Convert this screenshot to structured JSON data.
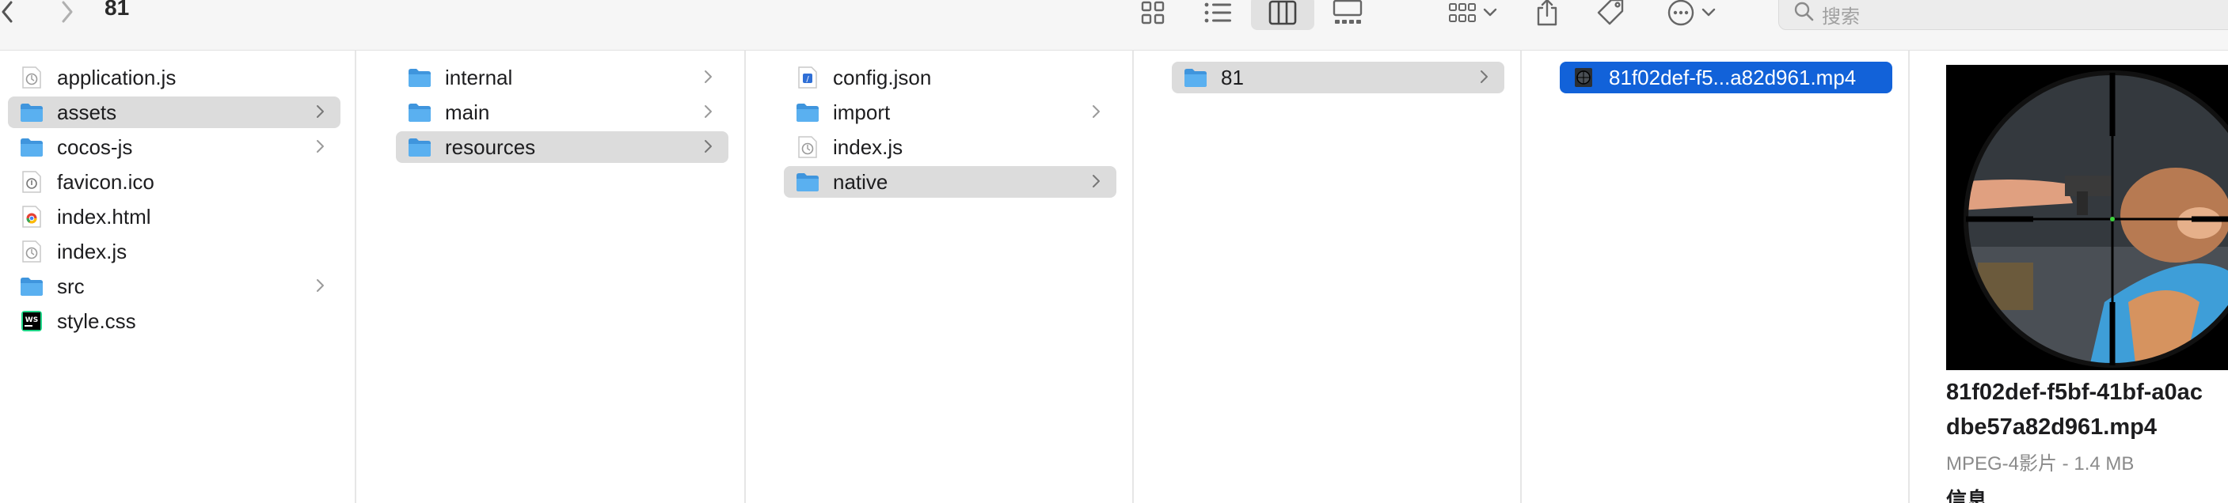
{
  "window": {
    "title": "81"
  },
  "toolbar": {
    "back_icon": "chevron-left-icon",
    "forward_icon": "chevron-right-icon",
    "views": [
      "icon-view",
      "list-view",
      "column-view",
      "gallery-view"
    ],
    "active_view": "column-view",
    "search_placeholder": "搜索"
  },
  "columns": [
    {
      "items": [
        {
          "label": "application.js",
          "icon": "js-file-icon"
        },
        {
          "label": "assets",
          "icon": "folder-icon",
          "folder": true,
          "selected": true
        },
        {
          "label": "cocos-js",
          "icon": "folder-icon",
          "folder": true
        },
        {
          "label": "favicon.ico",
          "icon": "ico-file-icon"
        },
        {
          "label": "index.html",
          "icon": "chrome-html-icon"
        },
        {
          "label": "index.js",
          "icon": "js-file-icon"
        },
        {
          "label": "src",
          "icon": "folder-icon",
          "folder": true
        },
        {
          "label": "style.css",
          "icon": "webstorm-css-icon"
        }
      ]
    },
    {
      "items": [
        {
          "label": "internal",
          "icon": "folder-icon",
          "folder": true
        },
        {
          "label": "main",
          "icon": "folder-icon",
          "folder": true
        },
        {
          "label": "resources",
          "icon": "folder-icon",
          "folder": true,
          "selected": true
        }
      ]
    },
    {
      "items": [
        {
          "label": "config.json",
          "icon": "json-file-icon"
        },
        {
          "label": "import",
          "icon": "folder-icon",
          "folder": true
        },
        {
          "label": "index.js",
          "icon": "js-file-icon"
        },
        {
          "label": "native",
          "icon": "folder-icon",
          "folder": true,
          "selected": true
        }
      ]
    },
    {
      "items": [
        {
          "label": "81",
          "icon": "folder-icon",
          "folder": true,
          "selected": true
        }
      ]
    },
    {
      "items": [
        {
          "label": "81f02def-f5...a82d961.mp4",
          "icon": "video-thumb-icon",
          "selected": true,
          "active": true
        }
      ]
    }
  ],
  "preview": {
    "name_line1": "81f02def-f5bf-41bf-a0ac",
    "name_line2": "dbe57a82d961.mp4",
    "meta": "MPEG-4影片 - 1.4 MB",
    "info_heading": "信息"
  },
  "colors": {
    "folder": "#4aa3e8",
    "selection_gray": "#dcdcdc",
    "selection_blue": "#1262d9"
  }
}
